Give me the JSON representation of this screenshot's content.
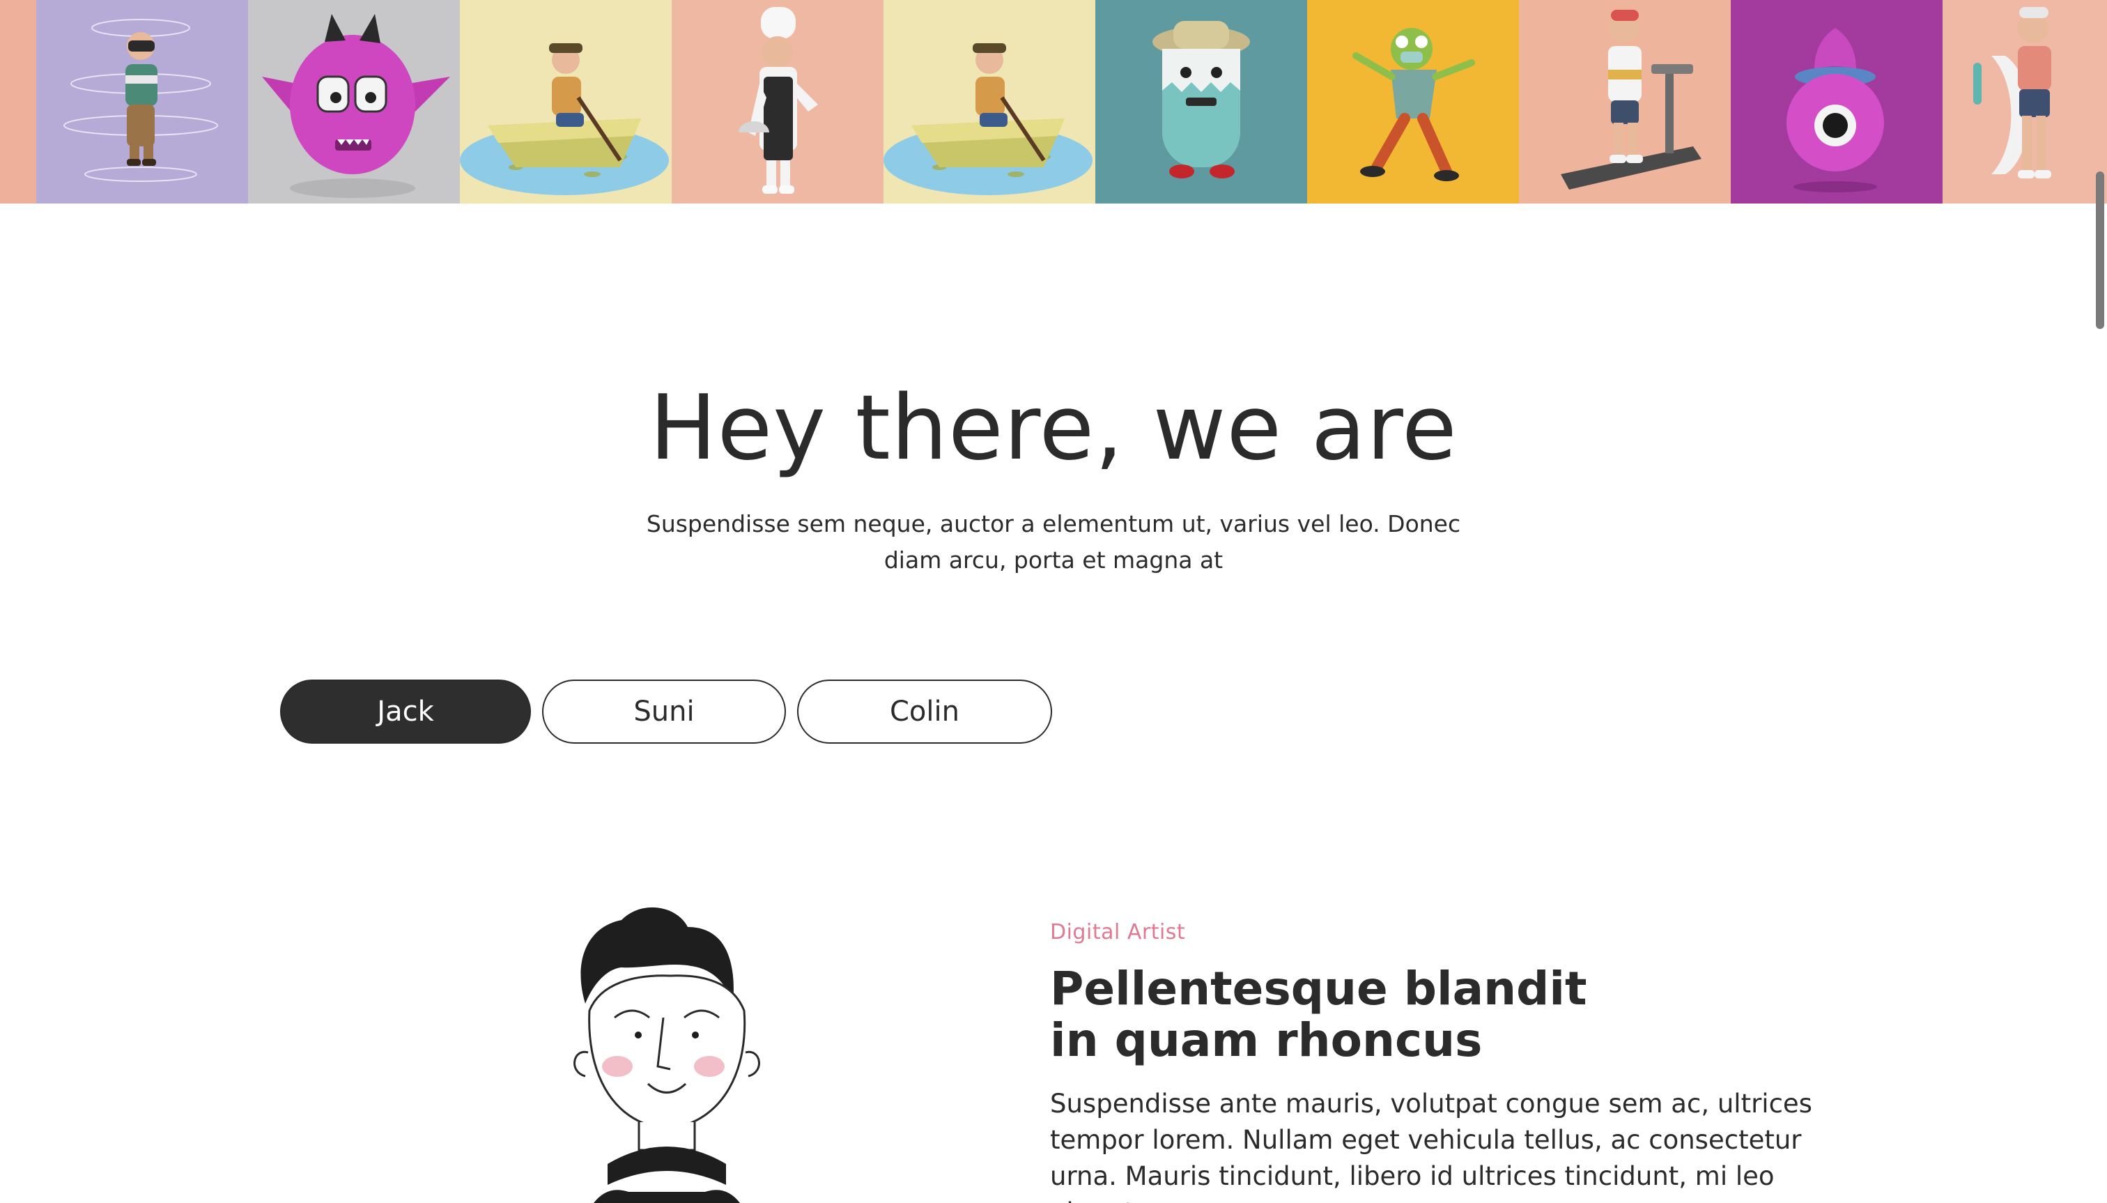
{
  "gallery": {
    "tiles": [
      {
        "name": "peach-edge",
        "bg": "#eeb09a"
      },
      {
        "name": "vr-character",
        "bg": "#b6abd6"
      },
      {
        "name": "pink-monster",
        "bg": "#c7c7c9"
      },
      {
        "name": "boat-character",
        "bg": "#efe6b4"
      },
      {
        "name": "chef-character",
        "bg": "#efb8a2"
      },
      {
        "name": "boat-character-2",
        "bg": "#efe6b4"
      },
      {
        "name": "teal-monster",
        "bg": "#5f9aa0"
      },
      {
        "name": "frog-character",
        "bg": "#f2b733"
      },
      {
        "name": "treadmill-character",
        "bg": "#efb49c"
      },
      {
        "name": "purple-monster",
        "bg": "#a33a9e"
      },
      {
        "name": "surfer-character",
        "bg": "#efb9a6"
      }
    ]
  },
  "hero": {
    "title": "Hey there, we are",
    "subtitle": "Suspendisse sem neque, auctor a elementum ut, varius vel leo. Donec diam arcu, porta et magna at"
  },
  "tabs": {
    "jack": "Jack",
    "suni": "Suni",
    "colin": "Colin",
    "active": "Jack"
  },
  "profile": {
    "role": "Digital Artist",
    "title_line1": "Pellentesque blandit",
    "title_line2": "in quam rhoncus",
    "body": "Suspendisse ante mauris, volutpat congue sem ac, ultrices tempor lorem. Nullam eget vehicula tellus, ac consectetur urna. Mauris tincidunt, libero id ultrices tincidunt, mi leo pharetra"
  },
  "colors": {
    "accent_pink": "#e07a92",
    "dark": "#2e2e2e"
  }
}
